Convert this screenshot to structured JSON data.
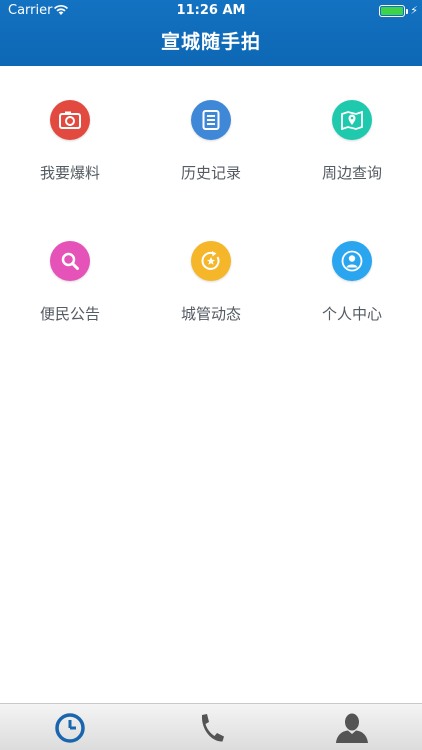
{
  "status_bar": {
    "carrier": "Carrier",
    "time": "11:26 AM",
    "battery_color": "#3fd34a"
  },
  "header": {
    "title": "宣城随手拍",
    "background": "#1372c1"
  },
  "menu": [
    {
      "label": "我要爆料",
      "icon": "camera-icon",
      "color": "#e34a3f"
    },
    {
      "label": "历史记录",
      "icon": "document-icon",
      "color": "#3f88d8"
    },
    {
      "label": "周边查询",
      "icon": "map-pin-icon",
      "color": "#1fc9ad"
    },
    {
      "label": "便民公告",
      "icon": "search-icon",
      "color": "#e552b8"
    },
    {
      "label": "城管动态",
      "icon": "star-refresh-icon",
      "color": "#f5b62a"
    },
    {
      "label": "个人中心",
      "icon": "user-icon",
      "color": "#2aa5ef"
    }
  ],
  "tabbar": {
    "tabs": [
      {
        "icon": "clock-icon",
        "color": "#1a66ae"
      },
      {
        "icon": "phone-icon",
        "color": "#545454"
      },
      {
        "icon": "person-icon",
        "color": "#545454"
      }
    ]
  }
}
